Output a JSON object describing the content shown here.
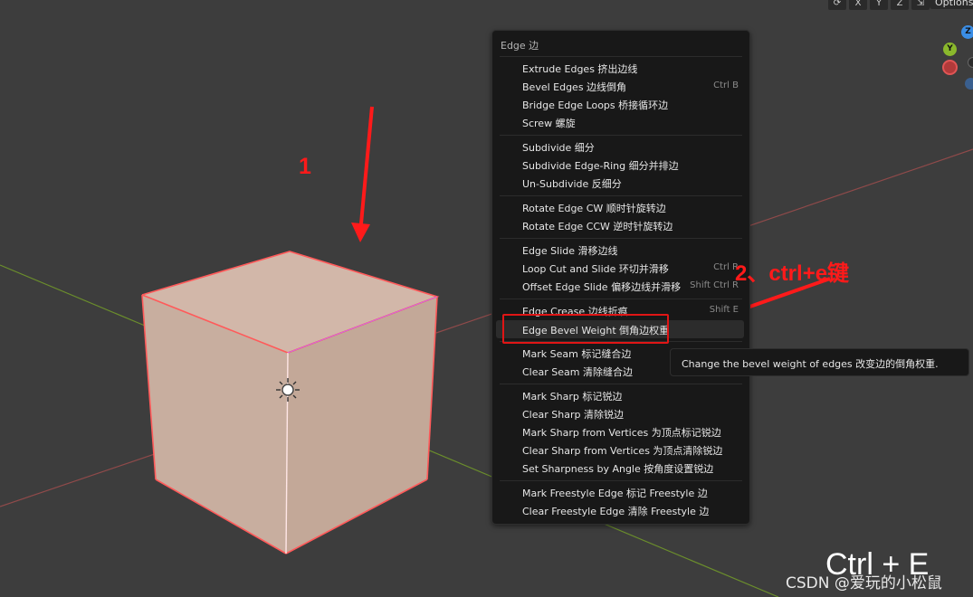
{
  "header": {
    "tools": [
      "⟳",
      "X",
      "Y",
      "Z",
      "⇲"
    ],
    "options_label": "Options"
  },
  "gizmo": {
    "z": "Z",
    "y": "Y"
  },
  "menu": {
    "title": "Edge 边",
    "items": [
      {
        "label": "Extrude Edges 挤出边线",
        "shortcut": ""
      },
      {
        "label": "Bevel Edges 边线倒角",
        "shortcut": "Ctrl B"
      },
      {
        "label": "Bridge Edge Loops 桥接循环边",
        "shortcut": ""
      },
      {
        "label": "Screw 螺旋",
        "shortcut": ""
      },
      {
        "label": "Subdivide 细分",
        "shortcut": ""
      },
      {
        "label": "Subdivide Edge-Ring 细分并排边",
        "shortcut": ""
      },
      {
        "label": "Un-Subdivide 反细分",
        "shortcut": ""
      },
      {
        "label": "Rotate Edge CW 顺时针旋转边",
        "shortcut": ""
      },
      {
        "label": "Rotate Edge CCW 逆时针旋转边",
        "shortcut": ""
      },
      {
        "label": "Edge Slide 滑移边线",
        "shortcut": ""
      },
      {
        "label": "Loop Cut and Slide 环切并滑移",
        "shortcut": "Ctrl R"
      },
      {
        "label": "Offset Edge Slide 偏移边线并滑移",
        "shortcut": "Shift Ctrl R"
      },
      {
        "label": "Edge Crease 边线折痕",
        "shortcut": "Shift E"
      },
      {
        "label": "Edge Bevel Weight 倒角边权重",
        "shortcut": ""
      },
      {
        "label": "Mark Seam 标记缝合边",
        "shortcut": ""
      },
      {
        "label": "Clear Seam 清除缝合边",
        "shortcut": ""
      },
      {
        "label": "Mark Sharp 标记锐边",
        "shortcut": ""
      },
      {
        "label": "Clear Sharp 清除锐边",
        "shortcut": ""
      },
      {
        "label": "Mark Sharp from Vertices 为顶点标记锐边",
        "shortcut": ""
      },
      {
        "label": "Clear Sharp from Vertices 为顶点清除锐边",
        "shortcut": ""
      },
      {
        "label": "Set Sharpness by Angle 按角度设置锐边",
        "shortcut": ""
      },
      {
        "label": "Mark Freestyle Edge 标记 Freestyle 边",
        "shortcut": ""
      },
      {
        "label": "Clear Freestyle Edge 清除 Freestyle 边",
        "shortcut": ""
      }
    ]
  },
  "tooltip": "Change the bevel weight of edges 改变边的倒角权重.",
  "annotations": {
    "step1": "1",
    "step2": "2、ctrl+e键"
  },
  "overlay_text": "Ctrl + E",
  "watermark": "CSDN @爱玩的小松鼠",
  "colors": {
    "background": "#3d3d3d",
    "menu_bg": "#181818",
    "highlight_bg": "#2c2c2c",
    "annotation_red": "#ff1a1a",
    "cube_face": "#c9afa0",
    "cube_edge": "#ff5a5a",
    "x_axis": "#8f4a4a",
    "y_axis": "#6b8e2c"
  }
}
